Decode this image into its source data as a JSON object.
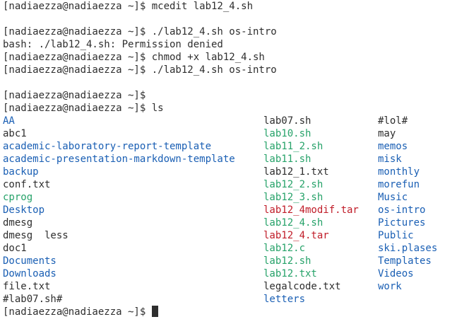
{
  "colors": {
    "directory": "#1a5fb4",
    "executable": "#26a269",
    "archive": "#c01c28",
    "text": "#2e2e2e",
    "background": "#ffffff"
  },
  "prompt": "[nadiaezza@nadiaezza ~]$ ",
  "history": [
    {
      "prompt": "[nadiaezza@nadiaezza ~]$ ",
      "text": "mcedit lab12_4.sh"
    },
    {
      "prompt": "",
      "text": ""
    },
    {
      "prompt": "[nadiaezza@nadiaezza ~]$ ",
      "text": "./lab12_4.sh os-intro"
    },
    {
      "prompt": "",
      "text": "bash: ./lab12_4.sh: Permission denied"
    },
    {
      "prompt": "[nadiaezza@nadiaezza ~]$ ",
      "text": "chmod +x lab12_4.sh"
    },
    {
      "prompt": "[nadiaezza@nadiaezza ~]$ ",
      "text": "./lab12_4.sh os-intro"
    },
    {
      "prompt": "",
      "text": ""
    },
    {
      "prompt": "[nadiaezza@nadiaezza ~]$ ",
      "text": ""
    },
    {
      "prompt": "[nadiaezza@nadiaezza ~]$ ",
      "text": "ls"
    }
  ],
  "ls_columns": [
    [
      {
        "name": "AA",
        "kind": "dir"
      },
      {
        "name": "abc1",
        "kind": "txt"
      },
      {
        "name": "academic-laboratory-report-template",
        "kind": "dir"
      },
      {
        "name": "academic-presentation-markdown-template",
        "kind": "dir"
      },
      {
        "name": "backup",
        "kind": "dir"
      },
      {
        "name": "conf.txt",
        "kind": "txt"
      },
      {
        "name": "cprog",
        "kind": "exe"
      },
      {
        "name": "Desktop",
        "kind": "dir"
      },
      {
        "name": "dmesg",
        "kind": "txt"
      },
      {
        "name": "dmesg  less",
        "kind": "txt"
      },
      {
        "name": "doc1",
        "kind": "txt"
      },
      {
        "name": "Documents",
        "kind": "dir"
      },
      {
        "name": "Downloads",
        "kind": "dir"
      },
      {
        "name": "file.txt",
        "kind": "txt"
      },
      {
        "name": "#lab07.sh#",
        "kind": "txt"
      }
    ],
    [
      {
        "name": "lab07.sh",
        "kind": "txt"
      },
      {
        "name": "lab10.sh",
        "kind": "exe"
      },
      {
        "name": "lab11_2.sh",
        "kind": "exe"
      },
      {
        "name": "lab11.sh",
        "kind": "exe"
      },
      {
        "name": "lab12_1.txt",
        "kind": "txt"
      },
      {
        "name": "lab12_2.sh",
        "kind": "exe"
      },
      {
        "name": "lab12_3.sh",
        "kind": "exe"
      },
      {
        "name": "lab12_4modif.tar",
        "kind": "arc"
      },
      {
        "name": "lab12_4.sh",
        "kind": "exe"
      },
      {
        "name": "lab12_4.tar",
        "kind": "arc"
      },
      {
        "name": "lab12.c",
        "kind": "exe"
      },
      {
        "name": "lab12.sh",
        "kind": "exe"
      },
      {
        "name": "lab12.txt",
        "kind": "exe"
      },
      {
        "name": "legalcode.txt",
        "kind": "txt"
      },
      {
        "name": "letters",
        "kind": "dir"
      }
    ],
    [
      {
        "name": "#lol#",
        "kind": "txt"
      },
      {
        "name": "may",
        "kind": "txt"
      },
      {
        "name": "memos",
        "kind": "dir"
      },
      {
        "name": "misk",
        "kind": "dir"
      },
      {
        "name": "monthly",
        "kind": "dir"
      },
      {
        "name": "morefun",
        "kind": "dir"
      },
      {
        "name": "Music",
        "kind": "dir"
      },
      {
        "name": "os-intro",
        "kind": "dir"
      },
      {
        "name": "Pictures",
        "kind": "dir"
      },
      {
        "name": "Public",
        "kind": "dir"
      },
      {
        "name": "ski.plases",
        "kind": "dir"
      },
      {
        "name": "Templates",
        "kind": "dir"
      },
      {
        "name": "Videos",
        "kind": "dir"
      },
      {
        "name": "work",
        "kind": "dir"
      }
    ]
  ],
  "final_prompt": "[nadiaezza@nadiaezza ~]$ ",
  "cursor_icon": "block-cursor-icon"
}
